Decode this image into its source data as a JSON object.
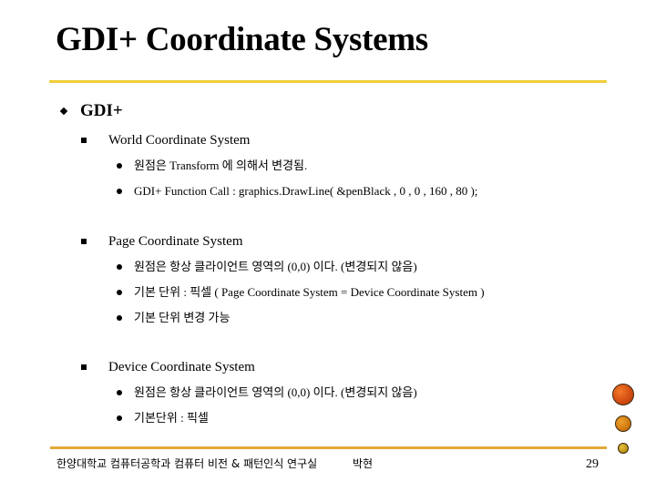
{
  "slide": {
    "title": "GDI+ Coordinate Systems",
    "outline": {
      "heading": "GDI+",
      "sections": [
        {
          "label": "World Coordinate System",
          "bullets": [
            "원점은 Transform 에 의해서 변경됨.",
            "GDI+ Function Call : graphics.DrawLine( &penBlack , 0 , 0 , 160 , 80 );"
          ]
        },
        {
          "label": "Page Coordinate System",
          "bullets": [
            "원점은 항상 클라이언트 영역의 (0,0) 이다. (변경되지 않음)",
            "기본 단위 : 픽셀  (  Page Coordinate System =  Device Coordinate System )",
            "기본 단위 변경 가능"
          ]
        },
        {
          "label": "Device Coordinate System",
          "bullets": [
            "원점은 항상 클라이언트 영역의 (0,0) 이다. (변경되지 않음)",
            "기본단위 : 픽셀"
          ]
        }
      ]
    },
    "footer": {
      "affiliation": "한양대학교  컴퓨터공학과   컴퓨터 비전 & 패턴인식 연구실",
      "author": "박현",
      "page_number": "29"
    },
    "colors": {
      "top_rule": "#F0CE3C",
      "bottom_rule": "#E3A83A",
      "decor_large": "#D04A10",
      "decor_medium": "#D07A10",
      "decor_small": "#C09818"
    }
  }
}
